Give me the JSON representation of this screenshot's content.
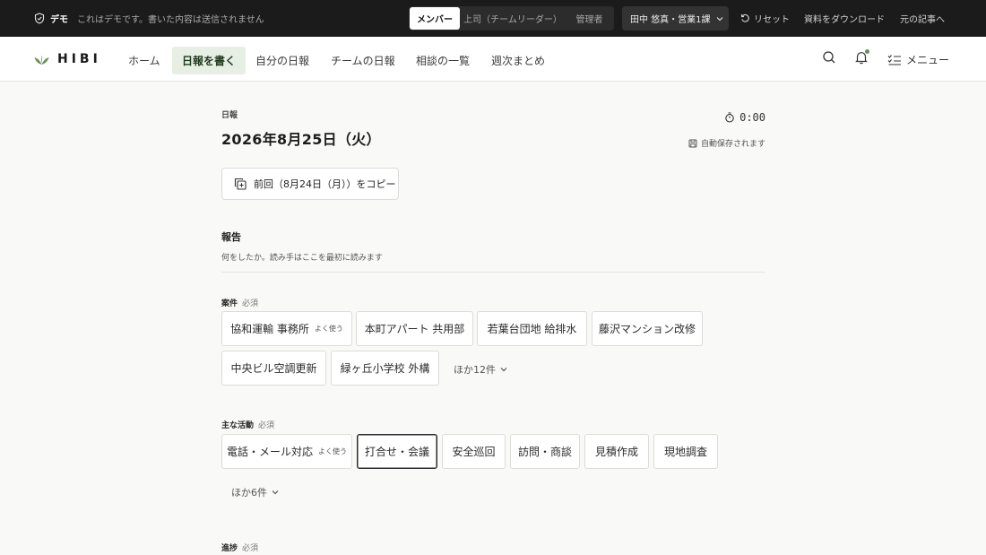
{
  "demo_bar": {
    "badge": "デモ",
    "note": "これはデモです。書いた内容は送信されません",
    "roles": [
      {
        "label": "メンバー",
        "active": true
      },
      {
        "label": "上司（チームリーダー）",
        "active": false
      },
      {
        "label": "管理者",
        "active": false
      }
    ],
    "user": "田中 悠真・営業1課",
    "reset": "リセット",
    "download": "資料をダウンロード",
    "original": "元の記事へ"
  },
  "nav": {
    "logo": "HIBI",
    "items": [
      {
        "label": "ホーム",
        "active": false
      },
      {
        "label": "日報を書く",
        "active": true
      },
      {
        "label": "自分の日報",
        "active": false
      },
      {
        "label": "チームの日報",
        "active": false
      },
      {
        "label": "相談の一覧",
        "active": false
      },
      {
        "label": "週次まとめ",
        "active": false
      }
    ],
    "menu": "メニュー"
  },
  "report": {
    "caption": "日報",
    "date": "2026年8月25日（火）",
    "timer": "0:00",
    "autosave": "自動保存されます",
    "copy_button": "前回（8月24日（月））をコピー",
    "section_title": "報告",
    "section_desc": "何をしたか。読み手はここを最初に読みます",
    "required": "必須",
    "frequent": "よく使う",
    "project": {
      "label": "案件",
      "chips": [
        "協和運輸 事務所",
        "本町アパート 共用部",
        "若葉台団地 給排水",
        "藤沢マンション改修",
        "中央ビル空調更新",
        "緑ヶ丘小学校 外構"
      ],
      "more": "ほか12件"
    },
    "activity": {
      "label": "主な活動",
      "chips": [
        "電話・メール対応",
        "打合せ・会議",
        "安全巡回",
        "訪問・商談",
        "見積作成",
        "現地調査"
      ],
      "selected": "打合せ・会議",
      "more": "ほか6件"
    },
    "progress": {
      "label": "進捗"
    }
  },
  "colors": {
    "demo_bar_bg": "#1b1b1b",
    "nav_active_bg": "#e7efe4",
    "accent_green": "#6a8f56"
  },
  "icons": [
    "shield-icon",
    "chevron-down-icon",
    "reset-icon",
    "leaf-logo-icon",
    "search-icon",
    "bell-icon",
    "checklist-icon",
    "timer-icon",
    "save-icon",
    "copy-icon"
  ]
}
